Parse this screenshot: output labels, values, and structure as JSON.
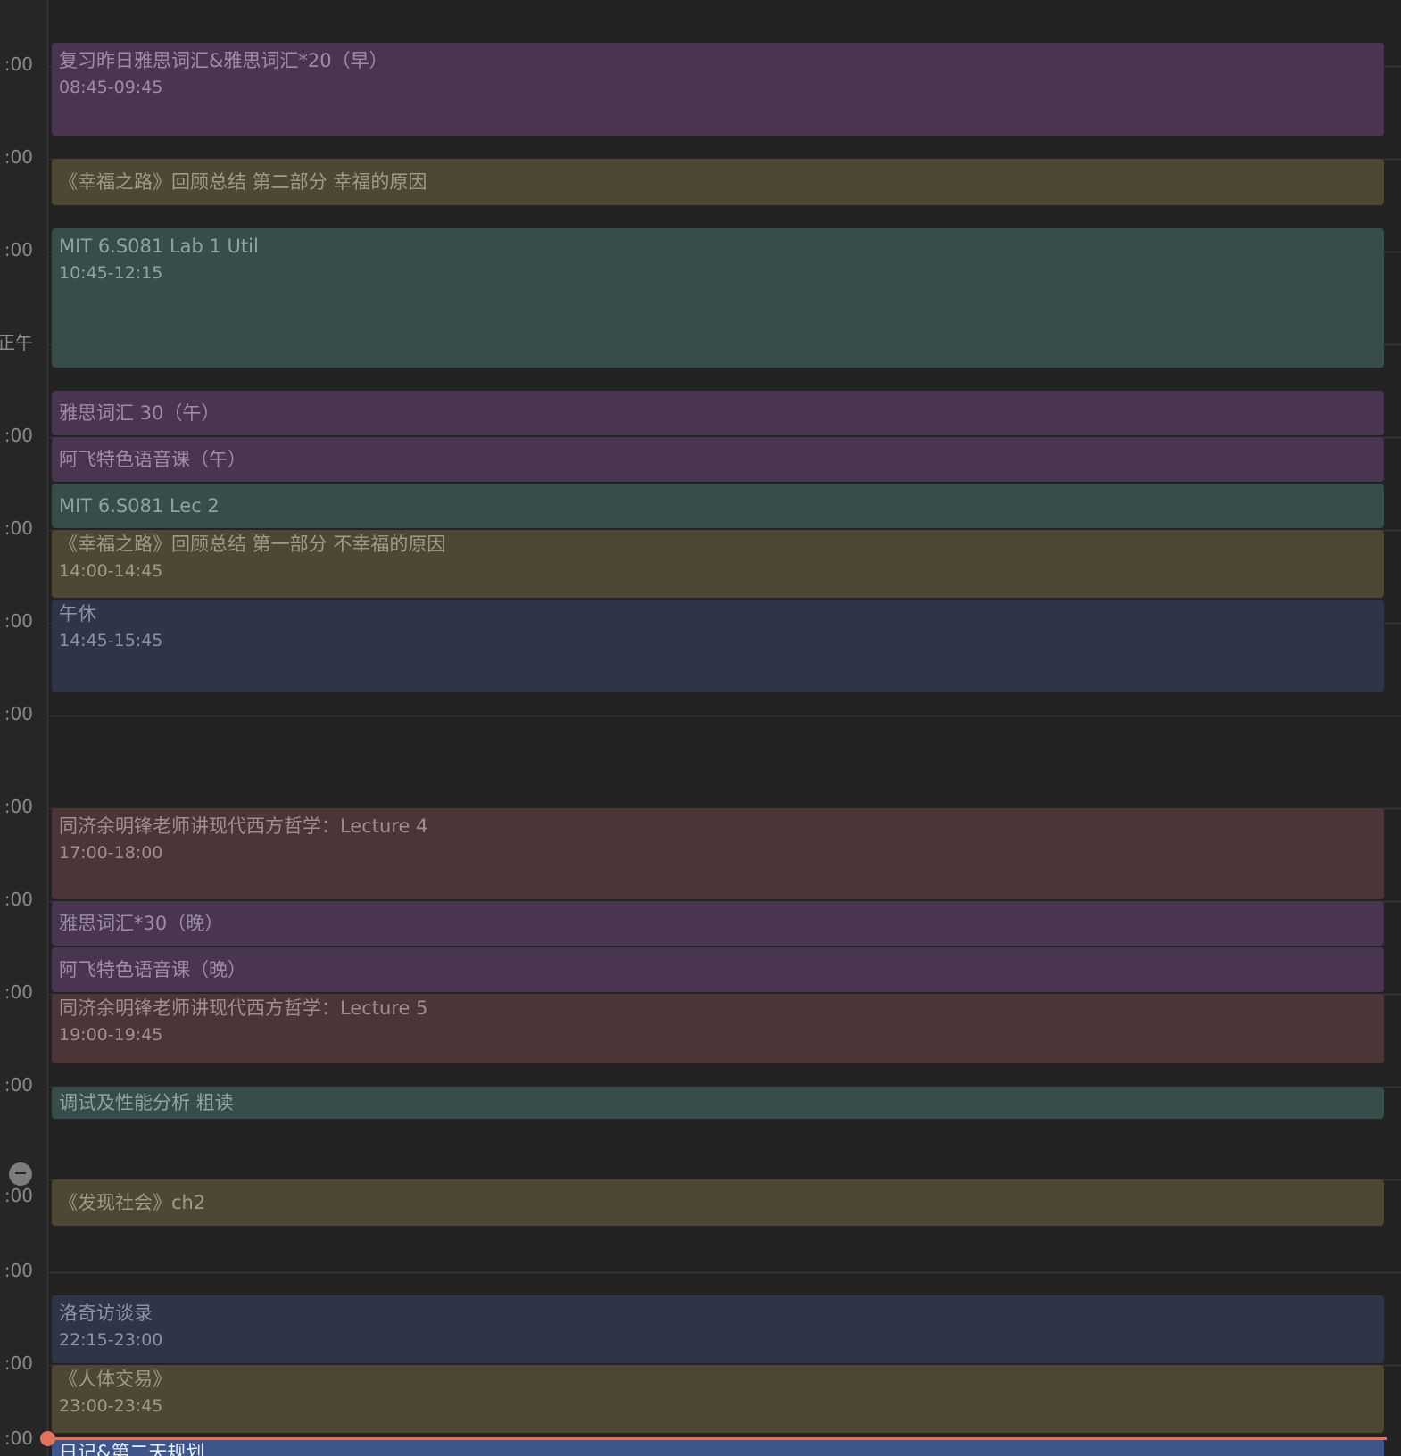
{
  "colors": {
    "background": "#232323",
    "purple": "#493550",
    "olive": "#4e4734",
    "teal": "#384c4b",
    "navy": "#2f3547",
    "maroon": "#4b3536",
    "blue": "#3e5589",
    "now_indicator": "#e2725b"
  },
  "hour_labels": [
    ":00",
    ":00",
    ":00",
    "正午",
    ":00",
    ":00",
    ":00",
    ":00",
    ":00",
    ":00",
    ":00",
    ":00",
    ":00",
    ":00",
    ":00",
    ":00"
  ],
  "events": [
    {
      "title": "复习昨日雅思词汇&雅思词汇*20（早）",
      "time": "08:45-09:45",
      "color": "purple"
    },
    {
      "title": "《幸福之路》回顾总结 第二部分 幸福的原因",
      "time": "",
      "color": "olive"
    },
    {
      "title": "MIT 6.S081 Lab 1 Util",
      "time": "10:45-12:15",
      "color": "teal"
    },
    {
      "title": "雅思词汇 30（午）",
      "time": "",
      "color": "purple"
    },
    {
      "title": "阿飞特色语音课（午）",
      "time": "",
      "color": "purple"
    },
    {
      "title": "MIT 6.S081 Lec 2",
      "time": "",
      "color": "teal"
    },
    {
      "title": "《幸福之路》回顾总结 第一部分 不幸福的原因",
      "time": "14:00-14:45",
      "color": "olive"
    },
    {
      "title": "午休",
      "time": "14:45-15:45",
      "color": "navy"
    },
    {
      "title": "同济余明锋老师讲现代西方哲学：Lecture 4",
      "time": "17:00-18:00",
      "color": "maroon"
    },
    {
      "title": "雅思词汇*30（晚）",
      "time": "",
      "color": "purple"
    },
    {
      "title": "阿飞特色语音课（晚）",
      "time": "",
      "color": "purple"
    },
    {
      "title": "同济余明锋老师讲现代西方哲学：Lecture 5",
      "time": "19:00-19:45",
      "color": "maroon"
    },
    {
      "title": "调试及性能分析 粗读",
      "time": "",
      "color": "teal"
    },
    {
      "title": "《发现社会》ch2",
      "time": "",
      "color": "olive"
    },
    {
      "title": "洛奇访谈录",
      "time": "22:15-23:00",
      "color": "navy"
    },
    {
      "title": "《人体交易》",
      "time": "23:00-23:45",
      "color": "olive"
    },
    {
      "title": "日记&第二天规划",
      "time": "",
      "color": "blue"
    }
  ]
}
